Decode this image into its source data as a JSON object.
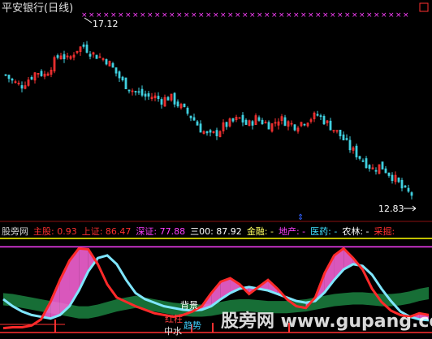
{
  "chart_data": [
    {
      "type": "candlestick",
      "title": "平安银行(日线)",
      "price_range": [
        12.4,
        17.6
      ],
      "high_label": "17.12",
      "low_label": "12.83",
      "close_trend": [
        16.2,
        16.0,
        15.9,
        16.1,
        16.3,
        16.2,
        16.5,
        16.8,
        16.6,
        16.9,
        17.0,
        16.8,
        16.7,
        16.6,
        16.3,
        16.0,
        15.8,
        15.7,
        15.6,
        15.6,
        15.5,
        15.6,
        15.4,
        15.2,
        15.0,
        14.7,
        14.5,
        14.6,
        14.8,
        14.9,
        15.0,
        14.8,
        15.0,
        14.9,
        14.8,
        15.0,
        14.9,
        14.8,
        14.9,
        15.0,
        15.1,
        14.9,
        14.7,
        14.5,
        14.2,
        14.0,
        13.8,
        13.6,
        13.7,
        13.5,
        13.3,
        13.0,
        12.9
      ],
      "color_up": "#ff3333",
      "color_down": "#40d0e0"
    },
    {
      "type": "oscillator",
      "legend": [
        {
          "label": "股旁网",
          "value": "",
          "color": "#d0d0d0"
        },
        {
          "label": "主股:",
          "value": "0.93",
          "color": "#ff3030"
        },
        {
          "label": "上证:",
          "value": "86.47",
          "color": "#ff3030"
        },
        {
          "label": "深证:",
          "value": "77.88",
          "color": "#ff40ff"
        },
        {
          "label": "三00:",
          "value": "87.92",
          "color": "#ffffff"
        },
        {
          "label": "金融:",
          "value": "-",
          "color": "#ffff60"
        },
        {
          "label": "地产:",
          "value": "-",
          "color": "#ff40ff"
        },
        {
          "label": "医药:",
          "value": "-",
          "color": "#40e0ff"
        },
        {
          "label": "农林:",
          "value": "-",
          "color": "#ffffff"
        },
        {
          "label": "采掘:",
          "value": "",
          "color": "#ff3030"
        }
      ],
      "reference_lines": {
        "top": 100,
        "upper": 95,
        "bottom": 0
      },
      "series": [
        {
          "name": "红线",
          "color": "#ff2a2a",
          "values": [
            5,
            6,
            6,
            8,
            15,
            35,
            60,
            82,
            96,
            95,
            78,
            55,
            40,
            35,
            30,
            26,
            22,
            20,
            18,
            20,
            24,
            30,
            45,
            58,
            62,
            55,
            44,
            52,
            60,
            50,
            38,
            30,
            28,
            40,
            68,
            88,
            96,
            85,
            72,
            50,
            35,
            25,
            20,
            18,
            22,
            20
          ]
        },
        {
          "name": "青线",
          "color": "#7fe6ff",
          "values": [
            38,
            30,
            24,
            20,
            18,
            16,
            20,
            30,
            48,
            70,
            85,
            88,
            78,
            60,
            45,
            38,
            34,
            30,
            28,
            26,
            25,
            26,
            30,
            38,
            45,
            50,
            52,
            50,
            48,
            44,
            40,
            36,
            34,
            36,
            46,
            60,
            72,
            78,
            76,
            66,
            50,
            36,
            24,
            18,
            15,
            14
          ]
        },
        {
          "name": "绿带",
          "color": "#1a7a3c",
          "values": [
            45,
            44,
            42,
            40,
            38,
            36,
            34,
            32,
            30,
            30,
            32,
            35,
            38,
            40,
            42,
            40,
            38,
            36,
            34,
            33,
            32,
            32,
            33,
            35,
            37,
            38,
            38,
            37,
            36,
            36,
            36,
            37,
            38,
            40,
            42,
            44,
            45,
            46,
            46,
            45,
            44,
            44,
            45,
            47,
            50,
            52
          ]
        }
      ],
      "annotations": [
        "背景",
        "红柱",
        "中水",
        "趋势"
      ],
      "watermark": "股旁网 www.gupang.com"
    }
  ],
  "colors": {
    "top_line": "#ffff00",
    "upper_line": "#ff40ff",
    "bottom_line": "#ff3030",
    "markers": "#ff40ff",
    "white_marks": "#ffffff"
  }
}
